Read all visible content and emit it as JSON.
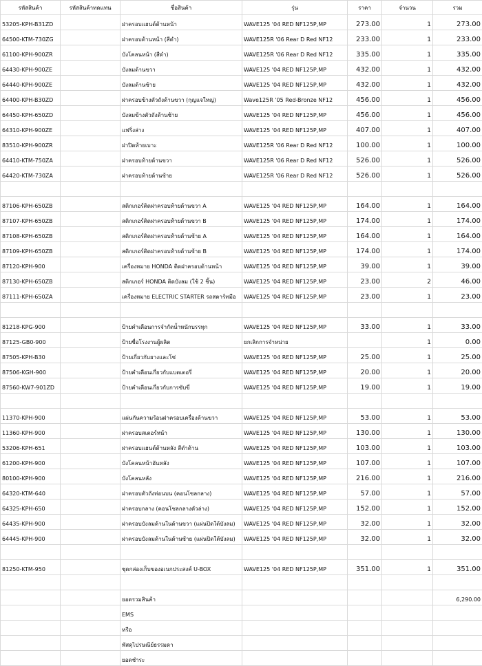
{
  "headers": [
    "รหัสสินค้า",
    "รหัสสินค้าทดแทน",
    "ชื่อสินค้า",
    "รุ่น",
    "ราคา",
    "จำนวน",
    "รวม"
  ],
  "groups": [
    [
      {
        "code": "53205-KPH-B31ZD",
        "name": "ฝาครอบแฮนด์ด้านหน้า",
        "model": "WAVE125 '04 RED NF125P,MP",
        "price": "273.00",
        "qty": "1",
        "total": "273.00"
      },
      {
        "code": "64500-KTM-730ZG",
        "name": "ฝาครอบด้านหน้า (สีดำ)",
        "model": "WAVE125R '06 Rear D Red NF12",
        "price": "233.00",
        "qty": "1",
        "total": "233.00"
      },
      {
        "code": "61100-KPH-900ZR",
        "name": "บังโคลนหน้า (สีดำ)",
        "model": "WAVE125R '06 Rear D Red NF12",
        "price": "335.00",
        "qty": "1",
        "total": "335.00"
      },
      {
        "code": "64430-KPH-900ZE",
        "name": "บังลมด้านขวา",
        "model": "WAVE125 '04 RED NF125P,MP",
        "price": "432.00",
        "qty": "1",
        "total": "432.00"
      },
      {
        "code": "64440-KPH-900ZE",
        "name": "บังลมด้านซ้าย",
        "model": "WAVE125 '04 RED NF125P,MP",
        "price": "432.00",
        "qty": "1",
        "total": "432.00"
      },
      {
        "code": "64400-KPH-B30ZD",
        "name": "ฝาครอบข้างตัวถังด้านขวา (กุญแจใหญ่)",
        "model": "Wave125R '05 Red-Bronze NF12",
        "price": "456.00",
        "qty": "1",
        "total": "456.00"
      },
      {
        "code": "64450-KPH-650ZD",
        "name": "บังลมข้างตัวถังด้านซ้าย",
        "model": "WAVE125 '04 RED NF125P,MP",
        "price": "456.00",
        "qty": "1",
        "total": "456.00"
      },
      {
        "code": "64310-KPH-900ZE",
        "name": "แฟริ่งล่าง",
        "model": "WAVE125 '04 RED NF125P,MP",
        "price": "407.00",
        "qty": "1",
        "total": "407.00"
      },
      {
        "code": "83510-KPH-900ZR",
        "name": "ฝาปิดท้ายเบาะ",
        "model": "WAVE125R '06 Rear D Red NF12",
        "price": "100.00",
        "qty": "1",
        "total": "100.00"
      },
      {
        "code": "64410-KTM-750ZA",
        "name": "ฝาครอบท้ายด้านขวา",
        "model": "WAVE125R '06 Rear D Red NF12",
        "price": "526.00",
        "qty": "1",
        "total": "526.00"
      },
      {
        "code": "64420-KTM-730ZA",
        "name": "ฝาครอบท้ายด้านซ้าย",
        "model": "WAVE125R '06 Rear D Red NF12",
        "price": "526.00",
        "qty": "1",
        "total": "526.00"
      }
    ],
    [
      {
        "code": "87106-KPH-650ZB",
        "name": "สติกเกอร์ติดฝาครอบท้ายด้านขวา A",
        "model": "WAVE125 '04 RED NF125P,MP",
        "price": "164.00",
        "qty": "1",
        "total": "164.00"
      },
      {
        "code": "87107-KPH-650ZB",
        "name": "สติกเกอร์ติดฝาครอบท้ายด้านขวา B",
        "model": "WAVE125 '04 RED NF125P,MP",
        "price": "174.00",
        "qty": "1",
        "total": "174.00"
      },
      {
        "code": "87108-KPH-650ZB",
        "name": "สติกเกอร์ติดฝาครอบท้ายด้านซ้าย A",
        "model": "WAVE125 '04 RED NF125P,MP",
        "price": "164.00",
        "qty": "1",
        "total": "164.00"
      },
      {
        "code": "87109-KPH-650ZB",
        "name": "สติกเกอร์ติดฝาครอบท้ายด้านซ้าย B",
        "model": "WAVE125 '04 RED NF125P,MP",
        "price": "174.00",
        "qty": "1",
        "total": "174.00"
      },
      {
        "code": "87120-KPH-900",
        "name": "เครื่องหมาย HONDA ติดฝาครอบด้านหน้า",
        "model": "WAVE125 '04 RED NF125P,MP",
        "price": "39.00",
        "qty": "1",
        "total": "39.00"
      },
      {
        "code": "87130-KPH-650ZB",
        "name": "สติกเกอร์ HONDA ติดบังลม (ใช้ 2 ชิ้น)",
        "model": "WAVE125 '04 RED NF125P,MP",
        "price": "23.00",
        "qty": "2",
        "total": "46.00"
      },
      {
        "code": "87111-KPH-650ZA",
        "name": "เครื่องหมาย ELECTRIC STARTER รถสตาร์ทมือ",
        "model": "WAVE125 '04 RED NF125P,MP",
        "price": "23.00",
        "qty": "1",
        "total": "23.00"
      }
    ],
    [
      {
        "code": "81218-KPG-900",
        "name": "ป้ายคำเตือนการจำกัดน้ำหนักบรรทุก",
        "model": "WAVE125 '04 RED NF125P,MP",
        "price": "33.00",
        "qty": "1",
        "total": "33.00"
      },
      {
        "code": "87125-GB0-900",
        "name": "ป้ายชื่อโรงงานผู้ผลิต",
        "model": "ยกเลิกการจำหน่าย",
        "price": "",
        "qty": "1",
        "total": "0.00"
      },
      {
        "code": "87505-KPH-B30",
        "name": "ป้ายเกี่ยวกับยางและโซ่",
        "model": "WAVE125 '04 RED NF125P,MP",
        "price": "25.00",
        "qty": "1",
        "total": "25.00"
      },
      {
        "code": "87506-KGH-900",
        "name": "ป้ายคำเตือนเกี่ยวกับแบตเตอรี่",
        "model": "WAVE125 '04 RED NF125P,MP",
        "price": "20.00",
        "qty": "1",
        "total": "20.00"
      },
      {
        "code": "87560-KW7-901ZD",
        "name": "ป้ายคำเตือนเกี่ยวกับการขับขี่",
        "model": "WAVE125 '04 RED NF125P,MP",
        "price": "19.00",
        "qty": "1",
        "total": "19.00"
      }
    ],
    [
      {
        "code": "11370-KPH-900",
        "name": "แผ่นกันความร้อนฝาครอบเครื่องด้านขวา",
        "model": "WAVE125 '04 RED NF125P,MP",
        "price": "53.00",
        "qty": "1",
        "total": "53.00"
      },
      {
        "code": "11360-KPH-900",
        "name": "ฝาครอบสเตอร์หน้า",
        "model": "WAVE125 '04 RED NF125P,MP",
        "price": "130.00",
        "qty": "1",
        "total": "130.00"
      },
      {
        "code": "53206-KPH-651",
        "name": "ฝาครอบแฮนด์ด้านหลัง สีดำด้าน",
        "model": "WAVE125 '04 RED NF125P,MP",
        "price": "103.00",
        "qty": "1",
        "total": "103.00"
      },
      {
        "code": "61200-KPH-900",
        "name": "บังโคลนหน้าอันหลัง",
        "model": "WAVE125 '04 RED NF125P,MP",
        "price": "107.00",
        "qty": "1",
        "total": "107.00"
      },
      {
        "code": "80100-KPH-900",
        "name": "บังโคลนหลัง",
        "model": "WAVE125 '04 RED NF125P,MP",
        "price": "216.00",
        "qty": "1",
        "total": "216.00"
      },
      {
        "code": "64320-KTM-640",
        "name": "ฝาครอบตัวถังท่อนบน (คอนโซลกลาง)",
        "model": "WAVE125 '04 RED NF125P,MP",
        "price": "57.00",
        "qty": "1",
        "total": "57.00"
      },
      {
        "code": "64325-KPH-650",
        "name": "ฝาครอบกลาง (คอนโซลกลางตัวล่าง)",
        "model": "WAVE125 '04 RED NF125P,MP",
        "price": "152.00",
        "qty": "1",
        "total": "152.00"
      },
      {
        "code": "64435-KPH-900",
        "name": "ฝาครอบบังลมด้านในด้านขวา (แผ่นปิดใต้บังลม)",
        "model": "WAVE125 '04 RED NF125P,MP",
        "price": "32.00",
        "qty": "1",
        "total": "32.00"
      },
      {
        "code": "64445-KPH-900",
        "name": "ฝาครอบบังลมด้านในด้านซ้าย (แผ่นปิดใต้บังลม)",
        "model": "WAVE125 '04 RED NF125P,MP",
        "price": "32.00",
        "qty": "1",
        "total": "32.00"
      }
    ],
    [
      {
        "code": "81250-KTM-950",
        "name": "ชุดกล่องเก็บของอเนกประสงค์ U-BOX",
        "model": "WAVE125 '04 RED NF125P,MP",
        "price": "351.00",
        "qty": "1",
        "total": "351.00"
      }
    ]
  ],
  "footer": [
    {
      "label": "ยอดรวมสินค้า",
      "value": "6,290.00"
    },
    {
      "label": "EMS",
      "value": ""
    },
    {
      "label": "หรือ",
      "value": ""
    },
    {
      "label": "พัสดุไปรษณีย์ธรรมดา",
      "value": ""
    },
    {
      "label": "ยอดชำระ",
      "value": ""
    }
  ]
}
